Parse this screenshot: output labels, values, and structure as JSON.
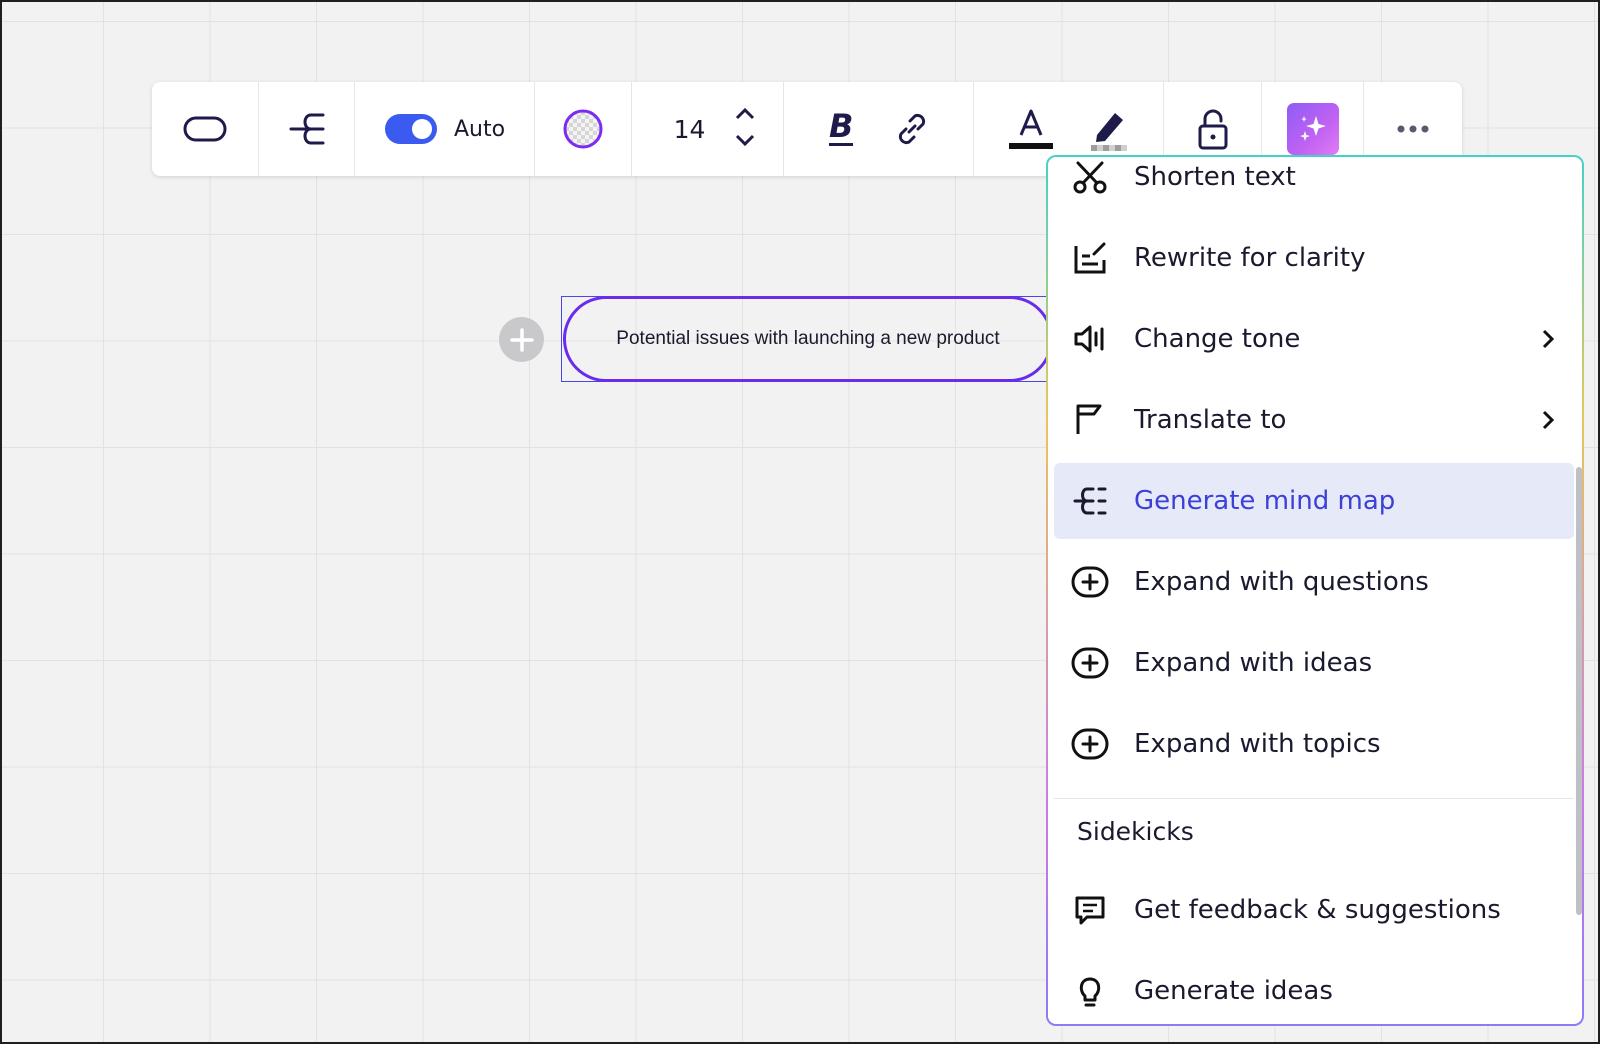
{
  "toolbar": {
    "shape_icon": "rounded-rectangle-icon",
    "mindmap_icon": "mindmap-branch-icon",
    "auto_toggle": {
      "label": "Auto",
      "on": true
    },
    "fill_icon": "transparent-fill-icon",
    "font_size": "14",
    "bold_icon": "bold-icon",
    "link_icon": "link-icon",
    "text_color_icon": "text-color-icon",
    "highlight_icon": "highlighter-icon",
    "lock_icon": "unlock-icon",
    "ai_icon": "sparkles-icon",
    "more_icon": "more-horizontal-icon"
  },
  "canvas": {
    "node_text": "Potential issues with launching a new product",
    "add_icon": "plus-icon"
  },
  "menu": {
    "items": [
      {
        "label": "Shorten text",
        "icon": "scissors-icon",
        "submenu": false
      },
      {
        "label": "Rewrite for clarity",
        "icon": "rewrite-icon",
        "submenu": false
      },
      {
        "label": "Change tone",
        "icon": "speaker-icon",
        "submenu": true
      },
      {
        "label": "Translate to",
        "icon": "flag-icon",
        "submenu": true
      },
      {
        "label": "Generate mind map",
        "icon": "mindmap-icon",
        "submenu": false,
        "active": true
      },
      {
        "label": "Expand with questions",
        "icon": "plus-circle-icon",
        "submenu": false
      },
      {
        "label": "Expand with ideas",
        "icon": "plus-circle-icon",
        "submenu": false
      },
      {
        "label": "Expand with topics",
        "icon": "plus-circle-icon",
        "submenu": false
      }
    ],
    "section_title": "Sidekicks",
    "sidekicks": [
      {
        "label": "Get feedback & suggestions",
        "icon": "feedback-icon"
      },
      {
        "label": "Generate ideas",
        "icon": "lightbulb-icon"
      }
    ]
  },
  "colors": {
    "accent": "#4a47e6",
    "shape_stroke": "#6a2bea",
    "active_bg": "#e6e9f8",
    "active_text": "#3d40d6",
    "toggle_on": "#3b5bf0"
  }
}
